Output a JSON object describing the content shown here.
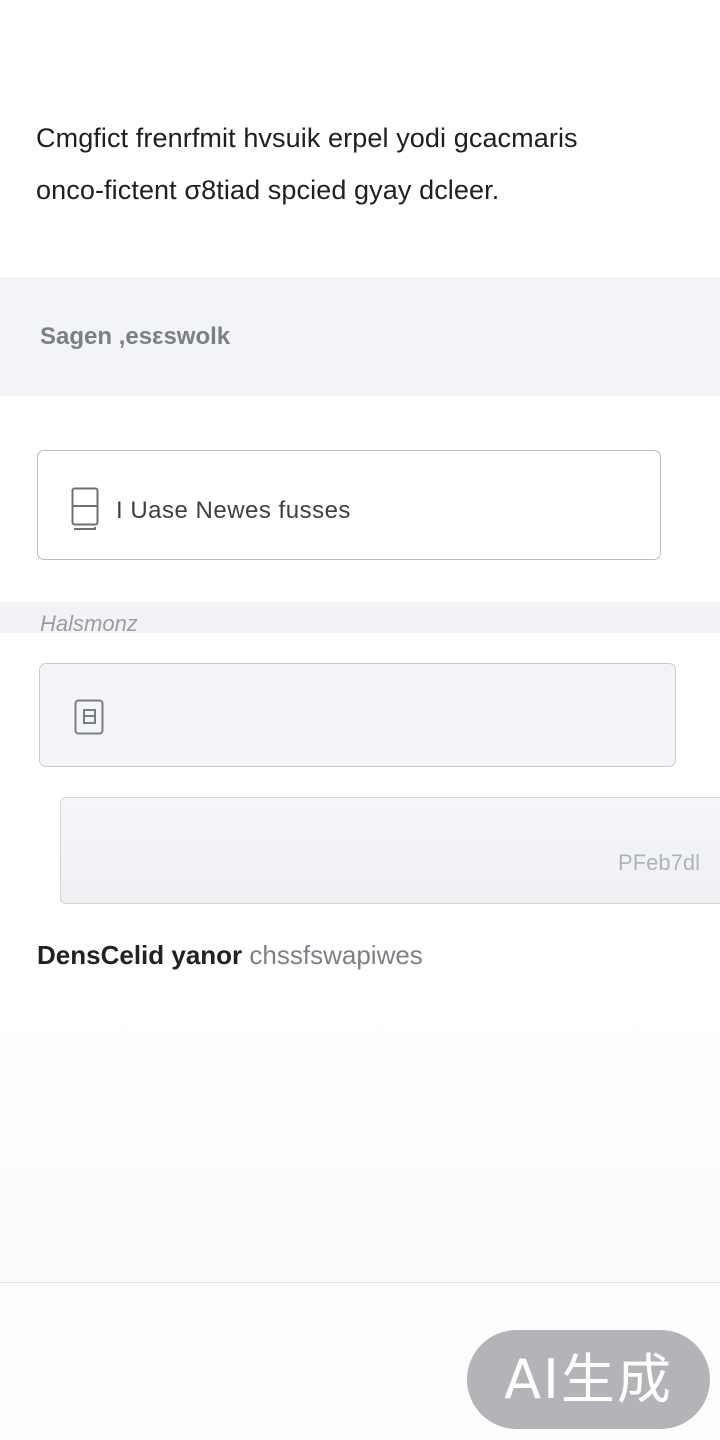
{
  "intro": {
    "line1": "Cmgfict frenrfmit hvsuik erpel yodi gcacmaris",
    "line2": "onco-fictent σ8tiad spcied gyay dcleer."
  },
  "section": {
    "title": "Sagen ,esεswolk"
  },
  "field1": {
    "icon": "document-icon",
    "value": "I Uase Newes fusses"
  },
  "subsection": {
    "label": "Halsmonz"
  },
  "field2": {
    "icon": "file-icon"
  },
  "field3": {
    "action_label": "PFeb7dl"
  },
  "bottom": {
    "part1": "DensCelid yanor",
    "part2": "chssfswapiwes"
  },
  "badge": {
    "label": "AI生成"
  }
}
